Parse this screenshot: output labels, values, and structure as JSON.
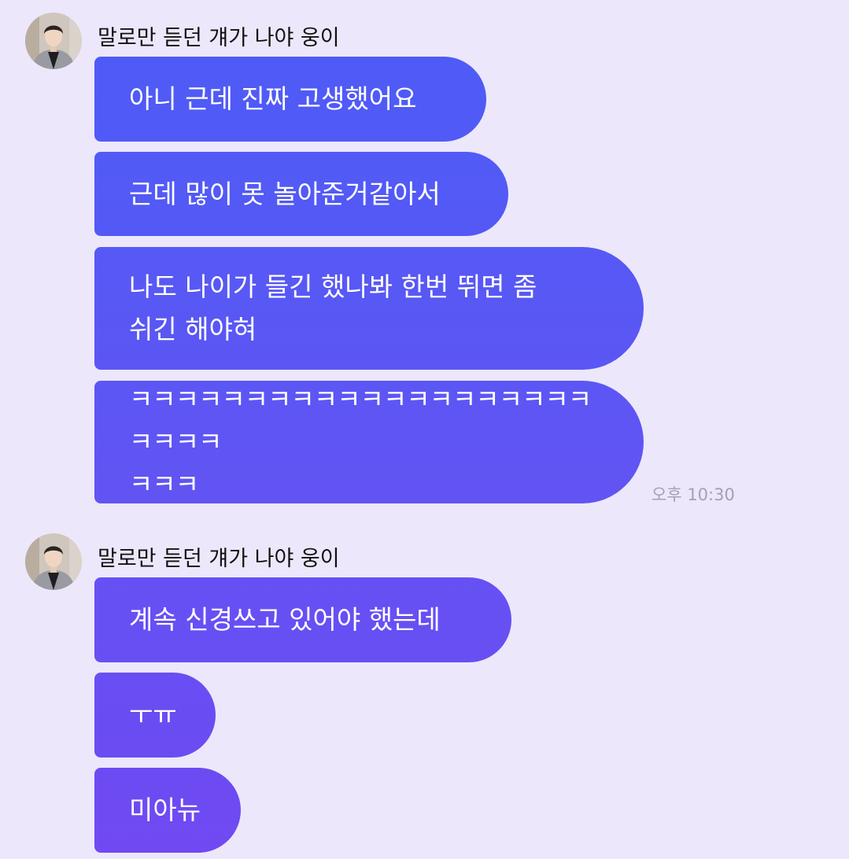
{
  "colors": {
    "background": "#ede7fb",
    "bubble_gradient_top": "#4f5cf6",
    "bubble_gradient_bottom": "#7149f2",
    "sender_text": "#111111",
    "timestamp_text": "#a6a0b5"
  },
  "groups": [
    {
      "sender": "말로만 듣던 걔가 나야 웅이",
      "avatar": "profile-photo-avatar",
      "messages": [
        "아니 근데 진짜 고생했어요",
        "근데 많이 못 놀아준거같아서",
        "나도 나이가 들긴 했나봐 한번 뛰면 좀\n쉬긴 해야혀",
        "ㅋㅋㅋㅋㅋㅋㅋㅋㅋㅋㅋㅋㅋㅋㅋㅋㅋㅋㅋㅋㅋㅋㅋㅋ\nㅋㅋㅋ"
      ],
      "timestamp": "오후 10:30"
    },
    {
      "sender": "말로만 듣던 걔가 나야 웅이",
      "avatar": "profile-photo-avatar",
      "messages": [
        "계속 신경쓰고 있어야 했는데",
        "ㅜㅠ",
        "미아뉴"
      ]
    }
  ]
}
